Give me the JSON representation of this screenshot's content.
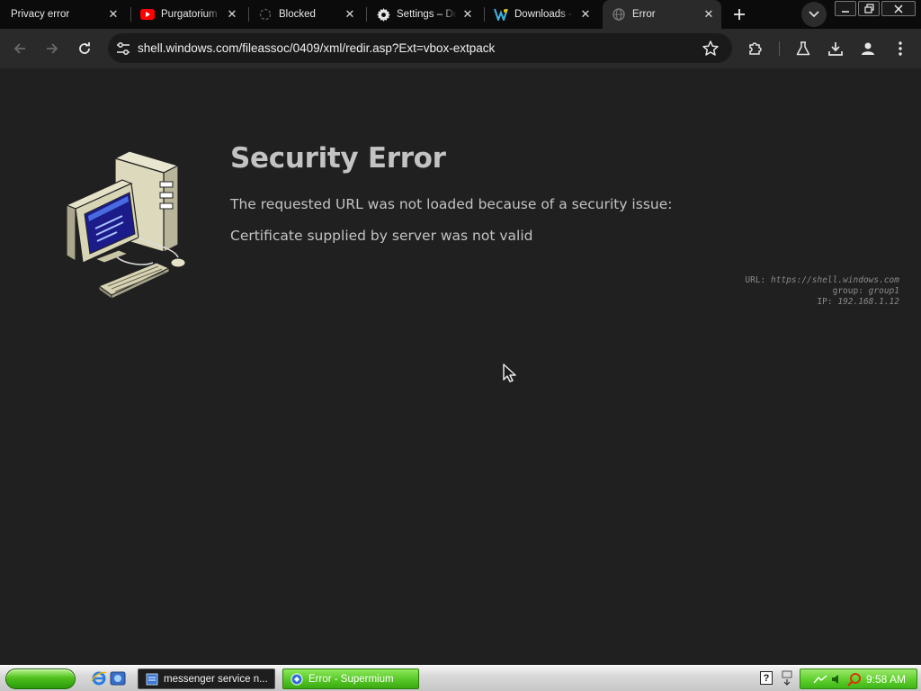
{
  "tabs": [
    {
      "title": "Privacy error",
      "icon": "none"
    },
    {
      "title": "Purgatorium",
      "icon": "youtube-icon"
    },
    {
      "title": "Blocked",
      "icon": "spinner-icon"
    },
    {
      "title": "Settings – De",
      "icon": "gear-icon"
    },
    {
      "title": "Downloads -",
      "icon": "downloads-site-icon"
    },
    {
      "title": "Error",
      "icon": "globe-icon",
      "active": true
    }
  ],
  "toolbar": {
    "url": "shell.windows.com/fileassoc/0409/xml/redir.asp?Ext=vbox-extpack"
  },
  "page": {
    "title": "Security Error",
    "line1": "The requested URL was not loaded because of a security issue:",
    "line2": "Certificate supplied by server was not valid",
    "diag": {
      "url_label": "URL:",
      "url_value": "https://shell.windows.com",
      "group_label": "group:",
      "group_value": "group1",
      "ip_label": "IP:",
      "ip_value": "192.168.1.12"
    }
  },
  "taskbar": {
    "tasks": [
      {
        "label": "messenger service n..."
      },
      {
        "label": "Error - Supermium"
      }
    ],
    "clock": "9:58 AM"
  },
  "colors": {
    "page_bg": "#202020",
    "tabstrip_bg": "#0b0b0b",
    "toolbar_bg": "#2a2a2a",
    "text": "#c3c3c3",
    "xp_green": "#4fc01d"
  }
}
